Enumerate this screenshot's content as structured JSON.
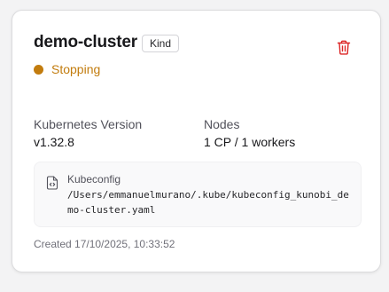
{
  "cluster": {
    "name": "demo-cluster",
    "type_badge": "Kind",
    "status": {
      "label": "Stopping",
      "color": "#c27c0e"
    },
    "delete_icon": "trash-icon",
    "delete_color": "#dc2626"
  },
  "stats": {
    "kubernetes_version": {
      "label": "Kubernetes Version",
      "value": "v1.32.8"
    },
    "nodes": {
      "label": "Nodes",
      "value": "1 CP / 1 workers"
    }
  },
  "kubeconfig": {
    "icon": "file-code-icon",
    "label": "Kubeconfig",
    "path": "/Users/emmanuelmurano/.kube/kubeconfig_kunobi_demo-cluster.yaml"
  },
  "created": "Created 17/10/2025, 10:33:52"
}
